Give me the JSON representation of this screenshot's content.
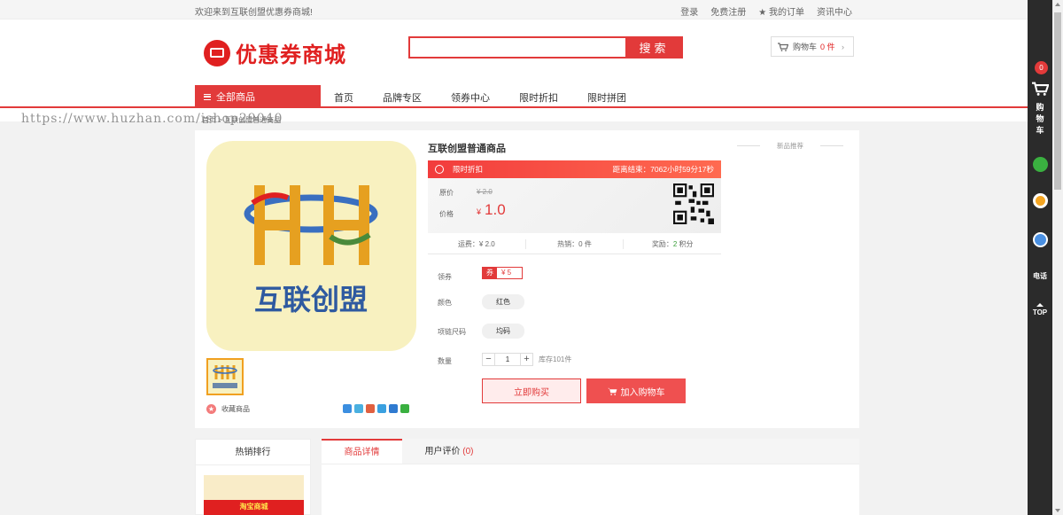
{
  "topbar": {
    "welcome": "欢迎来到互联创盟优惠券商城!",
    "links": [
      "登录",
      "免费注册",
      "★ 我的订单",
      "资讯中心"
    ]
  },
  "header": {
    "logo_text": "优惠券商城",
    "search_placeholder": "",
    "search_button": "搜索",
    "cart_label": "购物车",
    "cart_count": "0 件",
    "cart_arrow": "›"
  },
  "nav": {
    "all_label": "全部商品",
    "items": [
      "首页",
      "品牌专区",
      "领券中心",
      "限时折扣",
      "限时拼团"
    ]
  },
  "watermark": "https://www.huzhan.com/ishop29040",
  "breadcrumb": "首页 > 互联创盟普通商品",
  "product": {
    "title": "互联创盟普通商品",
    "promo_label": "限时折扣",
    "countdown": "距离结束：7062小时59分17秒",
    "orig_label": "原价",
    "orig_price": "¥ 2.0",
    "price_label": "价格",
    "price_currency": "¥",
    "price": "1.0",
    "shipping": "运费：¥ 2.0",
    "sales": "热销：0 件",
    "reward_prefix": "奖励：",
    "reward_points": "2",
    "reward_suffix": " 积分",
    "coupon_label": "领券",
    "coupon_tag": "券",
    "coupon_value": "¥ 5",
    "color_label": "颜色",
    "color_value": "红色",
    "size_label": "项链尺码",
    "size_value": "均码",
    "qty_label": "数量",
    "qty_minus": "−",
    "qty_value": "1",
    "qty_plus": "+",
    "stock": "库存101件",
    "buy_now": "立即购买",
    "add_cart": "加入购物车",
    "favorite": "收藏商品",
    "new_recommend": "新品推荐",
    "image_brand": "互联创盟"
  },
  "bottom": {
    "hot_title": "热销排行",
    "hot_banner": "淘宝商城",
    "tab_detail": "商品详情",
    "tab_review": "用户评价",
    "review_count": "(0)"
  },
  "sidebar": {
    "cart_count": "0",
    "cart_label": "购物车",
    "phone_label": "电话",
    "top_label": "TOP"
  },
  "colors": {
    "accent": "#e23a3a",
    "promo_gradient_end": "#ff6a50"
  }
}
